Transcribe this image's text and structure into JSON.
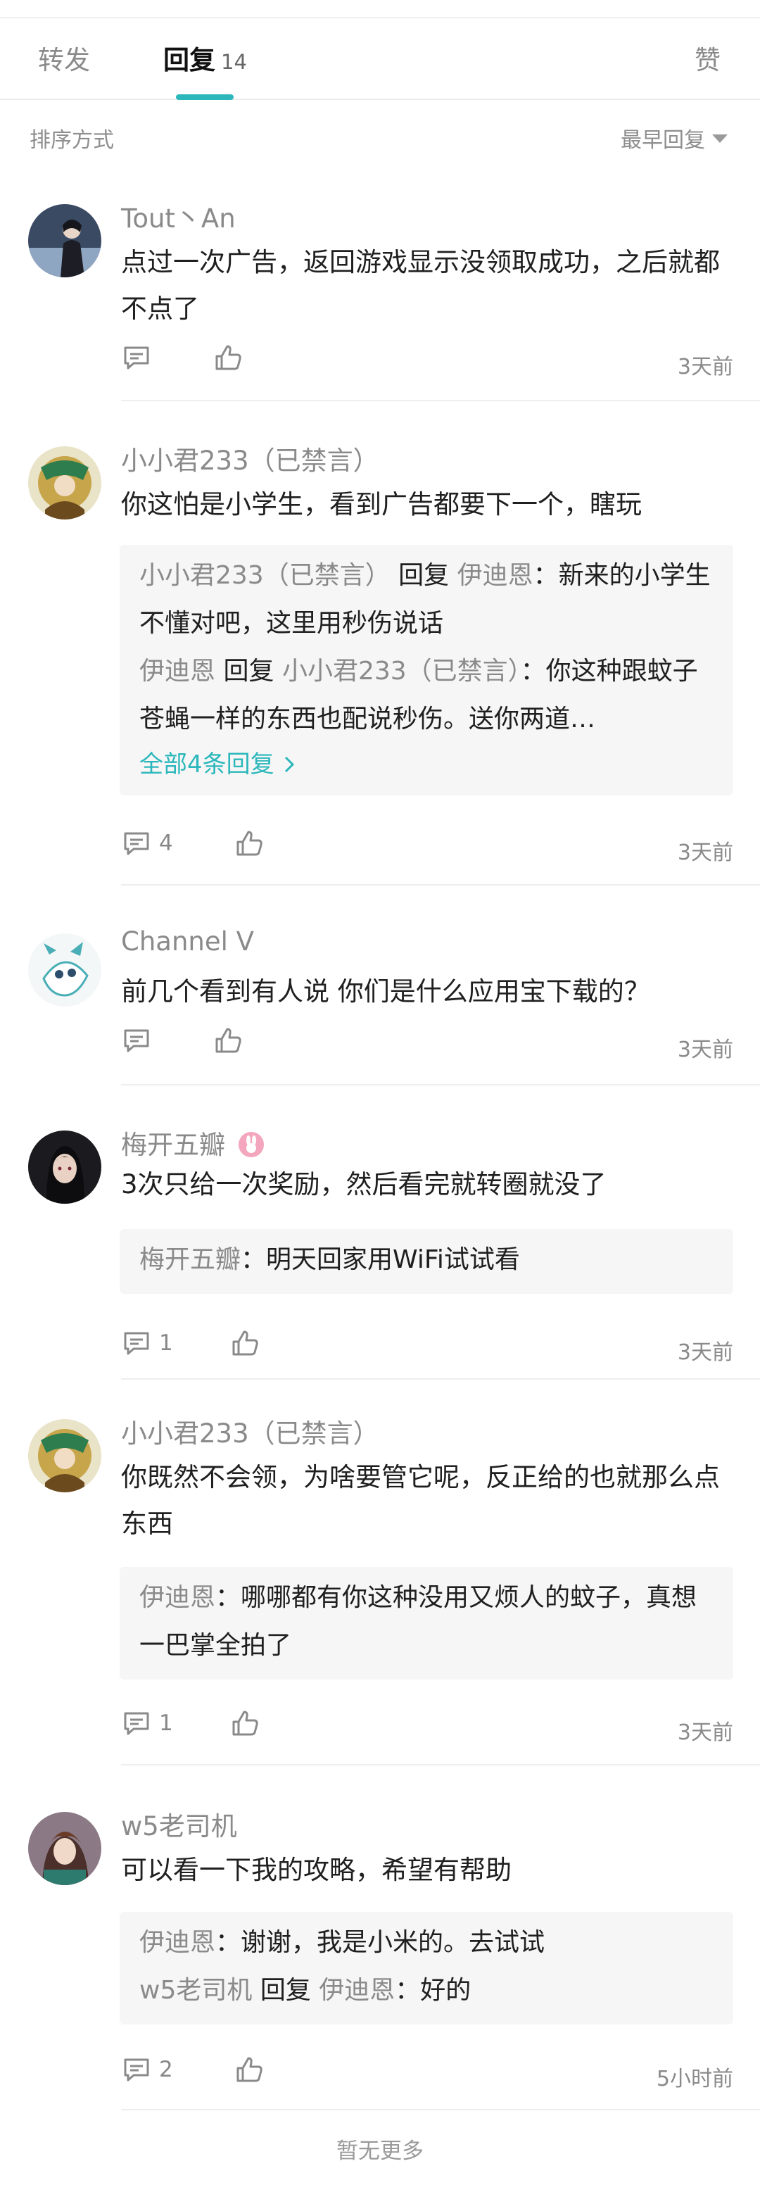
{
  "tabs": {
    "forward": "转发",
    "reply": "回复",
    "reply_count": "14",
    "like": "赞"
  },
  "sort": {
    "label": "排序方式",
    "value": "最早回复"
  },
  "comments": [
    {
      "author": "Tout丶An",
      "text": "点过一次广告，返回游戏显示没领取成功，之后就都不点了",
      "time": "3天前",
      "reply_count": ""
    },
    {
      "author": "小小君233（已禁言）",
      "text": "你这怕是小学生，看到广告都要下一个，瞎玩",
      "time": "3天前",
      "reply_count": "4",
      "replies": [
        {
          "from": "小小君233（已禁言）",
          "verb": "回复",
          "to": "伊迪恩",
          "text": "：新来的小学生不懂对吧，这里用秒伤说话"
        },
        {
          "from": "伊迪恩",
          "verb": "回复",
          "to": "小小君233（已禁言）",
          "text": "：你这种跟蚊子苍蝇一样的东西也配说秒伤。送你两道…"
        }
      ],
      "more": "全部4条回复"
    },
    {
      "author": "Channel V",
      "text": "前几个看到有人说 你们是什么应用宝下载的？",
      "time": "3天前",
      "reply_count": ""
    },
    {
      "author": "梅开五瓣",
      "text": "3次只给一次奖励，然后看完就转圈就没了",
      "time": "3天前",
      "reply_count": "1",
      "replies": [
        {
          "from": "梅开五瓣",
          "text": "：明天回家用WiFi试试看"
        }
      ]
    },
    {
      "author": "小小君233（已禁言）",
      "text": "你既然不会领，为啥要管它呢，反正给的也就那么点东西",
      "time": "3天前",
      "reply_count": "1",
      "replies": [
        {
          "from": "伊迪恩",
          "text": "：哪哪都有你这种没用又烦人的蚊子，真想一巴掌全拍了"
        }
      ]
    },
    {
      "author": "w5老司机",
      "text": "可以看一下我的攻略，希望有帮助",
      "time": "5小时前",
      "reply_count": "2",
      "replies": [
        {
          "from": "伊迪恩",
          "text": "：谢谢，我是小米的。去试试"
        },
        {
          "from": "w5老司机",
          "verb": "回复",
          "to": "伊迪恩",
          "text": "：好的"
        }
      ]
    }
  ],
  "footer": "暂无更多",
  "colors": {
    "accent": "#2bb7bb",
    "name_gray": "#8a8a8a",
    "reply_bg": "#f6f6f6",
    "badge_pink": "#f4a6bd"
  },
  "icons": [
    "comment-icon",
    "thumbs-up-icon",
    "caret-down-icon",
    "chevron-right-icon",
    "rabbit-badge-icon"
  ]
}
